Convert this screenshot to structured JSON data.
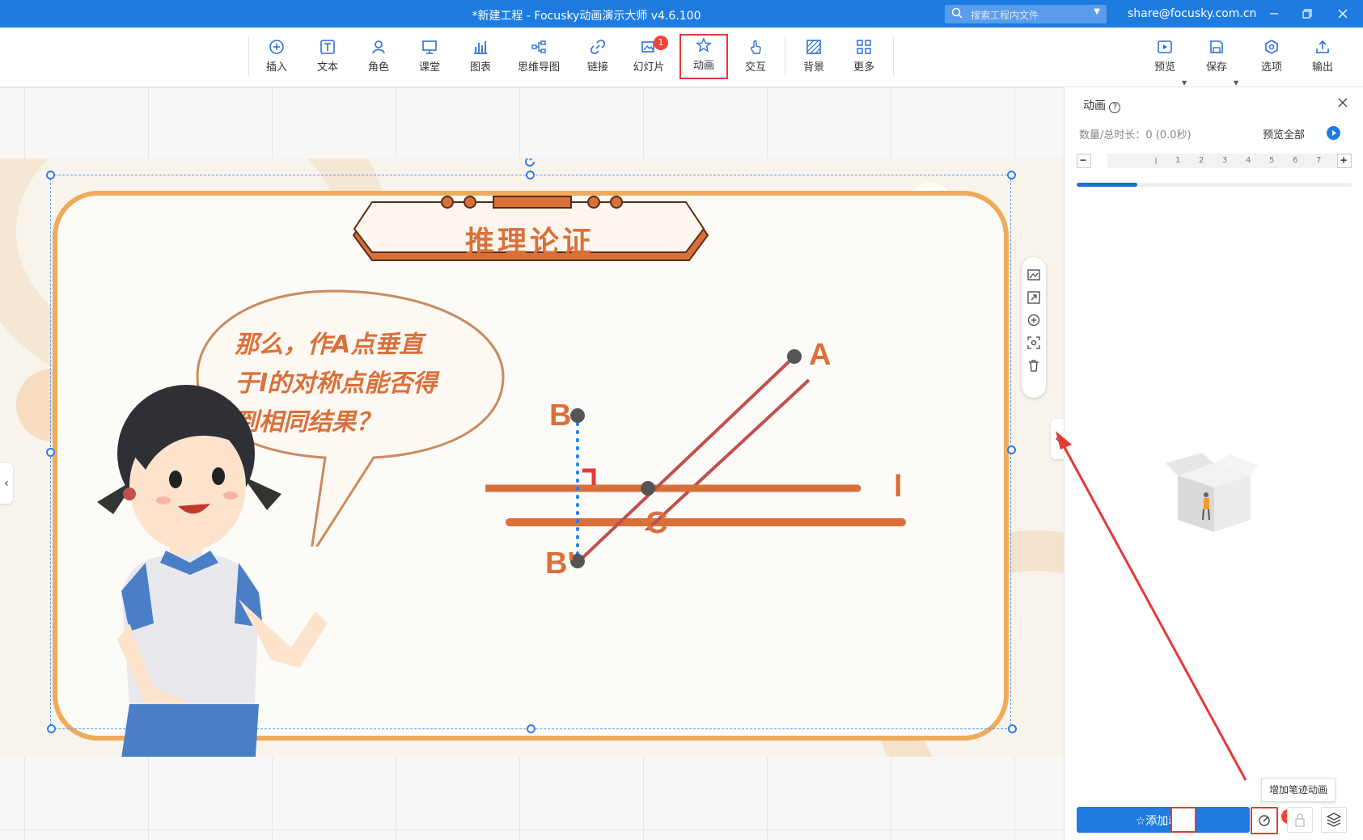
{
  "titlebar": {
    "title": "*新建工程 - Focusky动画演示大师  v4.6.100",
    "search_placeholder": "搜索工程内文件",
    "email": "share@focusky.com.cn"
  },
  "toolbar": {
    "items": [
      {
        "label": "插入",
        "icon": "insert-icon"
      },
      {
        "label": "文本",
        "icon": "text-icon"
      },
      {
        "label": "角色",
        "icon": "role-icon"
      },
      {
        "label": "课堂",
        "icon": "classroom-icon"
      },
      {
        "label": "图表",
        "icon": "chart-icon"
      },
      {
        "label": "思维导图",
        "icon": "mindmap-icon"
      },
      {
        "label": "链接",
        "icon": "link-icon"
      },
      {
        "label": "幻灯片",
        "icon": "slide-icon",
        "badge": "1"
      },
      {
        "label": "动画",
        "icon": "animation-icon",
        "active": true
      },
      {
        "label": "交互",
        "icon": "interact-icon"
      },
      {
        "label": "背景",
        "icon": "background-icon"
      },
      {
        "label": "更多",
        "icon": "more-icon"
      }
    ],
    "right_items": [
      {
        "label": "预览",
        "icon": "preview-icon"
      },
      {
        "label": "保存",
        "icon": "save-icon"
      },
      {
        "label": "选项",
        "icon": "options-icon"
      },
      {
        "label": "输出",
        "icon": "export-icon"
      }
    ]
  },
  "slide": {
    "banner_title": "推理论证",
    "bubble_lines": [
      "那么，作A点垂直",
      "于l的对称点能否得",
      "到相同结果？"
    ],
    "points": {
      "A": "A",
      "B": "B",
      "B_prime": "B'",
      "C": "C",
      "l": "l"
    }
  },
  "panel": {
    "title": "动画",
    "stats": "数量/总时长：0 (0.0秒)",
    "preview_all": "预览全部",
    "ruler_ticks": [
      "1",
      "2",
      "3",
      "4",
      "5",
      "6",
      "7"
    ],
    "progress": 0.22,
    "add_animation": "添加动画",
    "badge2": "2",
    "tooltip": "增加笔迹动画"
  },
  "colors": {
    "brand": "#1e7be0",
    "accent_orange": "#d9703a",
    "frame": "#f0ab5a",
    "highlight": "#e53935"
  }
}
